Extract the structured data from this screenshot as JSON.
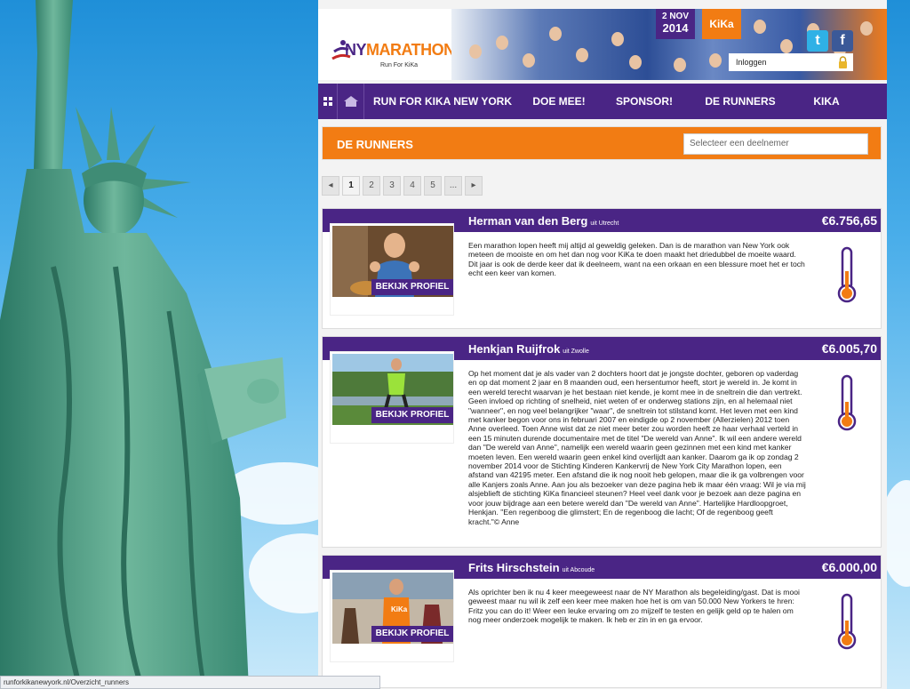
{
  "header": {
    "logo_ny": "NY",
    "logo_marathon": "MARATHON",
    "logo_sub": "Run For KiKa",
    "date_day": "2 NOV",
    "date_year": "2014",
    "kika_badge": "KiKa",
    "twitter_icon": "t",
    "facebook_icon": "f",
    "login_label": "Inloggen"
  },
  "nav": {
    "items": [
      "RUN FOR KIKA NEW YORK",
      "DOE MEE!",
      "SPONSOR!",
      "DE RUNNERS",
      "KIKA"
    ]
  },
  "section": {
    "title": "DE RUNNERS",
    "select_placeholder": "Selecteer een deelnemer"
  },
  "pager": {
    "prev": "◂",
    "pages": [
      "1",
      "2",
      "3",
      "4",
      "5",
      "..."
    ],
    "next": "▸",
    "current": "1"
  },
  "runners": [
    {
      "name": "Herman van den Berg",
      "from": "uit Utrecht",
      "amount": "€6.756,65",
      "button": "BEKIJK PROFIEL",
      "text": "Een marathon lopen heeft mij altijd al geweldig geleken. Dan is de marathon van New York ook meteen de mooiste en om het dan nog voor KiKa te doen maakt het driedubbel de moeite waard. Dit jaar is ook de derde keer dat ik deelneem, want na een orkaan en een blessure moet het er toch echt een keer van komen.",
      "thermometer_fill": 0.4
    },
    {
      "name": "Henkjan Ruijfrok",
      "from": "uit Zwolle",
      "amount": "€6.005,70",
      "button": "BEKIJK PROFIEL",
      "text": "Op het moment dat je als vader van 2 dochters hoort dat je jongste dochter, geboren op vaderdag en op dat moment 2 jaar en 8 maanden oud, een hersentumor heeft, stort je wereld in. Je komt in een wereld terecht waarvan je het bestaan niet kende, je komt mee in de sneltrein die dan vertrekt. Geen invloed op richting of snelheid, niet weten of er onderweg stations zijn, en al helemaal niet \"wanneer\", en nog veel belangrijker \"waar\", de sneltrein tot stilstand komt. Het leven met een kind met kanker begon voor ons in februari 2007 en eindigde op 2 november (Allerzielen) 2012 toen Anne overleed. Toen Anne wist dat ze niet meer beter zou worden heeft ze haar verhaal verteld in een 15 minuten durende documentaire met de titel \"De wereld van Anne\". Ik wil een andere wereld dan \"De wereld van Anne\", namelijk een wereld waarin geen gezinnen met een kind met kanker moeten leven. Een wereld waarin geen enkel kind overlijdt aan kanker. Daarom ga ik op zondag 2 november 2014 voor de Stichting Kinderen Kankervrij de New York City Marathon lopen, een afstand van 42195 meter. Een afstand die ik nog nooit heb gelopen, maar die ik ga volbrengen voor alle Kanjers zoals Anne. Aan jou als bezoeker van deze pagina heb ik maar één vraag: Wil je via mij alsjeblieft de stichting KiKa financieel steunen? Heel veel dank voor je bezoek aan deze pagina en voor jouw bijdrage aan een betere wereld dan \"De wereld van Anne\". Hartelijke Hardloopgroet, Henkjan. \"Een regenboog die glimstert; En de regenboog die lacht; Of de regenboog geeft kracht.\"© Anne",
      "thermometer_fill": 0.35
    },
    {
      "name": "Frits Hirschstein",
      "from": "uit Abcoude",
      "amount": "€6.000,00",
      "button": "BEKIJK PROFIEL",
      "text": "Als oprichter ben ik nu 4 keer meegeweest naar de NY Marathon als begeleiding/gast. Dat is mooi geweest maar nu wil ik zelf een keer mee maken hoe het is om van 50.000 New Yorkers te hren: Fritz you can do it! Weer een leuke ervaring om zo mijzelf te testen en gelijk geld op te halen om nog meer onderzoek mogelijk te maken. Ik heb er zin in en ga ervoor.",
      "thermometer_fill": 0.35
    }
  ],
  "status_url": "runforkikanewyork.nl/Overzicht_runners",
  "colors": {
    "purple": "#4a2585",
    "orange": "#f27c13"
  }
}
